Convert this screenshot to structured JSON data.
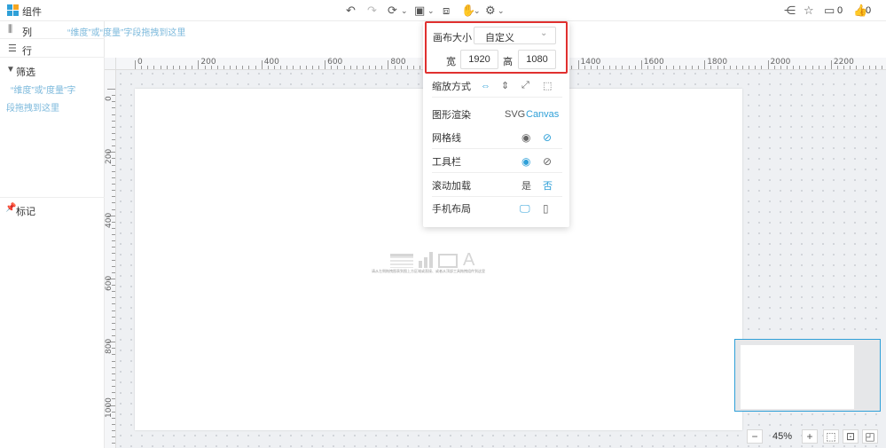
{
  "topbar": {
    "title": "组件",
    "share_icon": "share-icon",
    "star_icon": "star-icon",
    "comment_count": "0",
    "like_count": "0"
  },
  "fields": {
    "columns_label": "列",
    "rows_label": "行",
    "columns_hint": "“维度”或“度量”字段拖拽到这里"
  },
  "left": {
    "filter_label": "筛选",
    "filter_hint_line1": "“维度”或“度量”字",
    "filter_hint_line2": "段拖拽到这里",
    "mark_label": "标记"
  },
  "ruler": {
    "h_ticks": [
      "0",
      "200",
      "400",
      "600",
      "800",
      "1400",
      "1600",
      "1800",
      "2000",
      "2200"
    ],
    "v_ticks": [
      "0",
      "200",
      "400",
      "600",
      "800",
      "1000"
    ]
  },
  "popover": {
    "canvas_size_label": "画布大小",
    "canvas_size_value": "自定义",
    "width_label": "宽",
    "width_value": "1920",
    "height_label": "高",
    "height_value": "1080",
    "scale_label": "缩放方式",
    "render_label": "图形渲染",
    "render_svg": "SVG",
    "render_canvas": "Canvas",
    "grid_label": "网格线",
    "toolbar_label": "工具栏",
    "scroll_label": "滚动加载",
    "scroll_yes": "是",
    "scroll_no": "否",
    "mobile_label": "手机布局"
  },
  "page": {
    "empty_hint": "请从左侧拖拽图表到图上方区域或直接、或者从顶部工具拖拽组件到这里"
  },
  "zoom": {
    "value": "45%",
    "minus": "−",
    "plus": "+"
  },
  "colors": {
    "accent": "#2fa0d8",
    "highlight": "#e0302f"
  }
}
